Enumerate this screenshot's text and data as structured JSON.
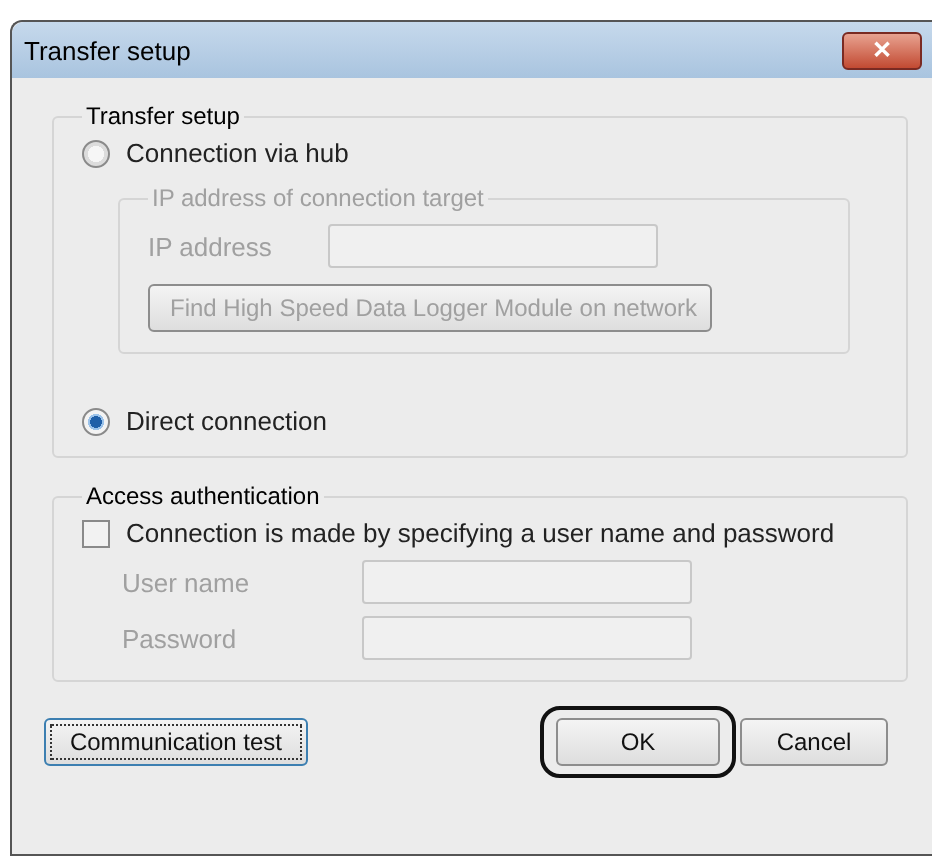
{
  "window": {
    "title": "Transfer setup",
    "close_glyph": "✕"
  },
  "transfer_setup": {
    "legend": "Transfer setup",
    "options": [
      {
        "label": "Connection via hub",
        "selected": false
      },
      {
        "label": "Direct connection",
        "selected": true
      }
    ],
    "ip_group": {
      "legend": "IP address of connection target",
      "disabled": true,
      "ip_label": "IP address",
      "find_button": "Find High Speed Data Logger Module on network"
    }
  },
  "access": {
    "legend": "Access authentication",
    "checkbox": {
      "label": "Connection is made by specifying a user name and password",
      "checked": false
    },
    "fields": [
      {
        "label": "User name",
        "disabled": true
      },
      {
        "label": "Password",
        "disabled": true
      }
    ]
  },
  "buttons": [
    {
      "label": "Communication test",
      "focused": true,
      "highlighted": false
    },
    {
      "label": "OK",
      "focused": false,
      "highlighted": true
    },
    {
      "label": "Cancel",
      "focused": false,
      "highlighted": false
    }
  ]
}
